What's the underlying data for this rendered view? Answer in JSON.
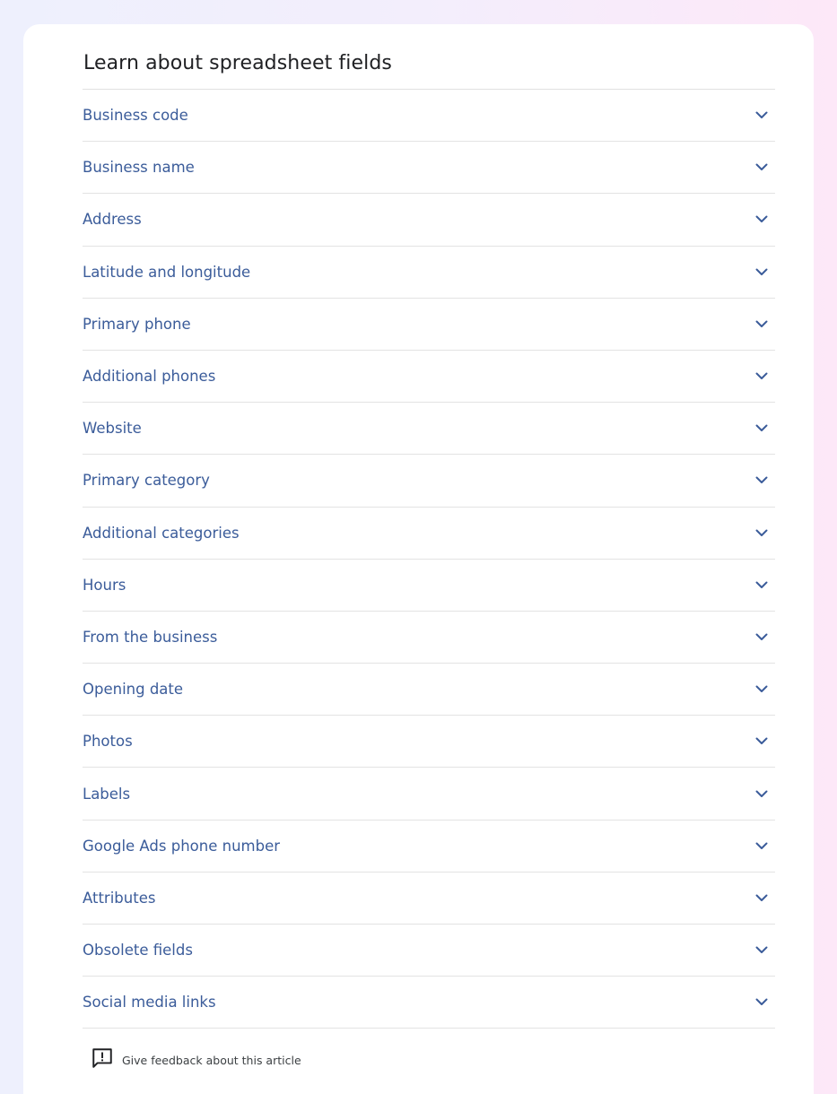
{
  "article": {
    "title": "Learn about spreadsheet fields",
    "fields": [
      {
        "label": "Business code"
      },
      {
        "label": "Business name"
      },
      {
        "label": "Address"
      },
      {
        "label": "Latitude and longitude"
      },
      {
        "label": "Primary phone"
      },
      {
        "label": "Additional phones"
      },
      {
        "label": "Website"
      },
      {
        "label": "Primary category"
      },
      {
        "label": "Additional categories"
      },
      {
        "label": "Hours"
      },
      {
        "label": "From the business"
      },
      {
        "label": "Opening date"
      },
      {
        "label": "Photos"
      },
      {
        "label": "Labels"
      },
      {
        "label": "Google Ads phone number"
      },
      {
        "label": "Attributes"
      },
      {
        "label": "Obsolete fields"
      },
      {
        "label": "Social media links"
      }
    ],
    "expand_icon": "chevron-down-icon",
    "accent_color": "#3b5c9a"
  },
  "feedback": {
    "label": "Give feedback about this article",
    "icon": "feedback-icon"
  }
}
